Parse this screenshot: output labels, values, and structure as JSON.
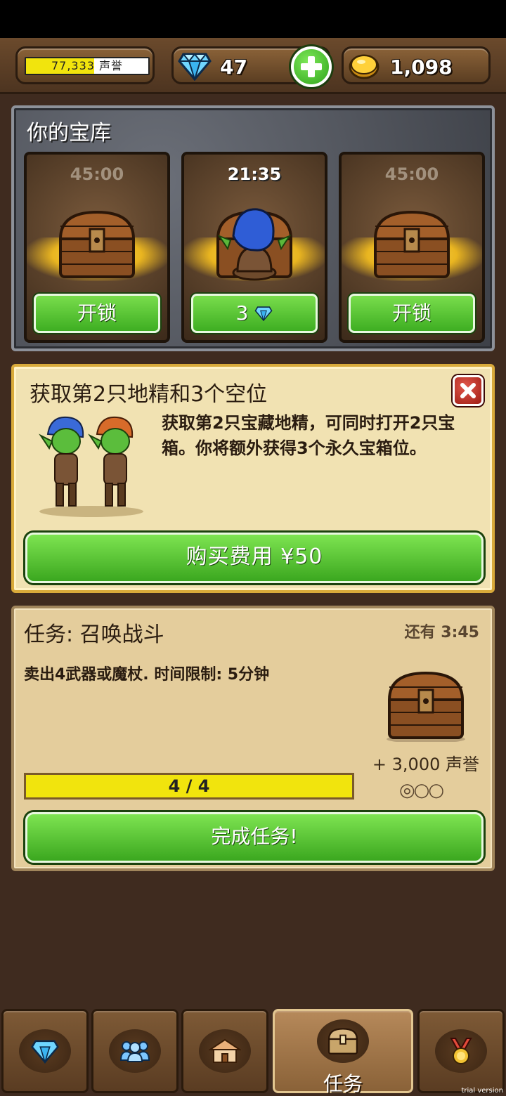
{
  "topbar": {
    "fame": {
      "value_text": "77,333",
      "unit": "声誉",
      "progress": 0.56
    },
    "gems": {
      "value": "47"
    },
    "coins": {
      "value": "1,098"
    }
  },
  "vault": {
    "title": "你的宝库",
    "slots": [
      {
        "timer": "45:00",
        "button_label": "开锁",
        "state": "locked"
      },
      {
        "timer": "21:35",
        "button_label": "3",
        "button_icon": "diamond-icon",
        "state": "unlocking"
      },
      {
        "timer": "45:00",
        "button_label": "开锁",
        "state": "locked"
      }
    ]
  },
  "offer": {
    "title": "获取第2只地精和3个空位",
    "description": "获取第2只宝藏地精，可同时打开2只宝箱。你将额外获得3个永久宝箱位。",
    "buy_label": "购买费用 ¥50"
  },
  "quest": {
    "title": "任务: 召唤战斗",
    "time_left": "还有 3:45",
    "description": "卖出4武器或魔杖. 时间限制: 5分钟",
    "reward": "+ 3,000 声誉",
    "dots": "◎○○",
    "progress_text": "4 / 4",
    "progress": 1.0,
    "complete_label": "完成任务!"
  },
  "bottom_nav": {
    "tabs": [
      {
        "icon": "diamond-icon",
        "label": ""
      },
      {
        "icon": "people-icon",
        "label": ""
      },
      {
        "icon": "house-icon",
        "label": ""
      },
      {
        "icon": "chest-icon",
        "label": "任务",
        "active": true
      },
      {
        "icon": "medal-icon",
        "label": ""
      }
    ]
  },
  "watermark": "trial version",
  "colors": {
    "accent_green": "#3ba71f",
    "gold": "#f1e40d",
    "panel_brown": "#3f2b1f"
  }
}
